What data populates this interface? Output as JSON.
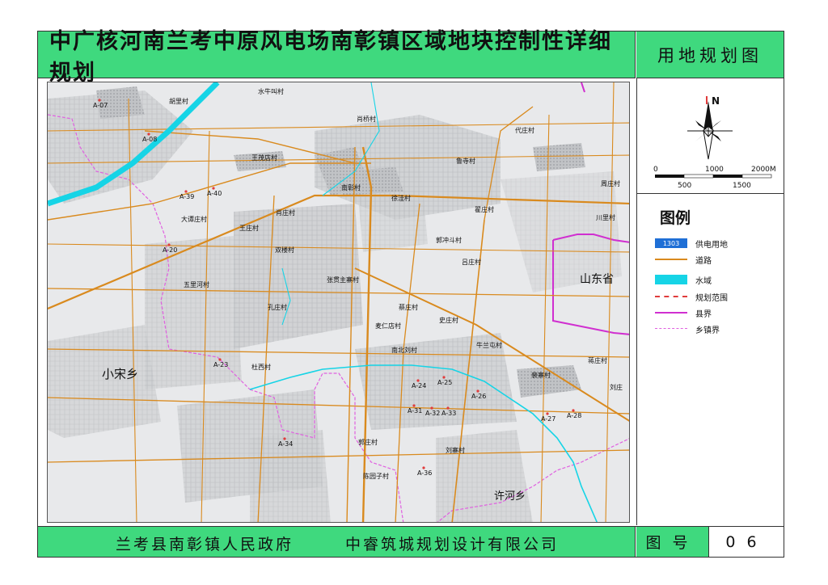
{
  "title": "中广核河南兰考中原风电场南彰镇区域地块控制性详细规划",
  "sheet_title": "用地规划图",
  "north_label": "N",
  "scale": {
    "top_labels": [
      "0",
      "1000",
      "2000M"
    ],
    "bottom_labels": [
      "500",
      "1500"
    ]
  },
  "legend": {
    "title": "图例",
    "items": [
      {
        "symbol_text": "1303",
        "label": "供电用地",
        "kind": "fill",
        "color": "#1f6fd6"
      },
      {
        "label": "道路",
        "kind": "road",
        "color": "#d98a1e"
      },
      {
        "label": "水域",
        "kind": "water",
        "color": "#16d4e6"
      },
      {
        "label": "规划范围",
        "kind": "dashed",
        "color": "#e03c3c"
      },
      {
        "label": "县界",
        "kind": "county",
        "color": "#d02fd0"
      },
      {
        "label": "乡镇界",
        "kind": "town",
        "color": "#e060e0"
      }
    ]
  },
  "footer": {
    "gov": "兰考县南彰镇人民政府",
    "company": "中睿筑城规划设计有限公司",
    "num_label": "图号",
    "num": "06"
  },
  "map": {
    "villages": [
      {
        "name": "水牛叫村"
      },
      {
        "name": "胡里村"
      },
      {
        "name": "肖桥村"
      },
      {
        "name": "代庄村"
      },
      {
        "name": "王茂店村"
      },
      {
        "name": "鲁寺村"
      },
      {
        "name": "南彰村"
      },
      {
        "name": "徐洼村"
      },
      {
        "name": "周庄村"
      },
      {
        "name": "大谭庄村"
      },
      {
        "name": "肖庄村"
      },
      {
        "name": "翟庄村"
      },
      {
        "name": "川里村"
      },
      {
        "name": "王庄村"
      },
      {
        "name": "郭冲斗村"
      },
      {
        "name": "双楼村"
      },
      {
        "name": "吕庄村"
      },
      {
        "name": "张贯主寨村"
      },
      {
        "name": "五里河村"
      },
      {
        "name": "孔庄村"
      },
      {
        "name": "蔡庄村"
      },
      {
        "name": "史庄村"
      },
      {
        "name": "麦仁店村"
      },
      {
        "name": "牛兰屯村"
      },
      {
        "name": "南北刘村"
      },
      {
        "name": "蒋庄村"
      },
      {
        "name": "杜西村"
      },
      {
        "name": "裴寨村"
      },
      {
        "name": "刘庄"
      },
      {
        "name": "郭庄村"
      },
      {
        "name": "刘寨村"
      },
      {
        "name": "陈园子村"
      }
    ],
    "regions": [
      {
        "name": "山东省"
      },
      {
        "name": "小宋乡"
      },
      {
        "name": "许河乡"
      }
    ],
    "sites": [
      {
        "id": "A-07"
      },
      {
        "id": "A-08"
      },
      {
        "id": "A-39"
      },
      {
        "id": "A-40"
      },
      {
        "id": "A-20"
      },
      {
        "id": "A-23"
      },
      {
        "id": "A-24"
      },
      {
        "id": "A-25"
      },
      {
        "id": "A-26"
      },
      {
        "id": "A-31"
      },
      {
        "id": "A-32"
      },
      {
        "id": "A-33"
      },
      {
        "id": "A-27"
      },
      {
        "id": "A-28"
      },
      {
        "id": "A-34"
      },
      {
        "id": "A-36"
      }
    ]
  }
}
